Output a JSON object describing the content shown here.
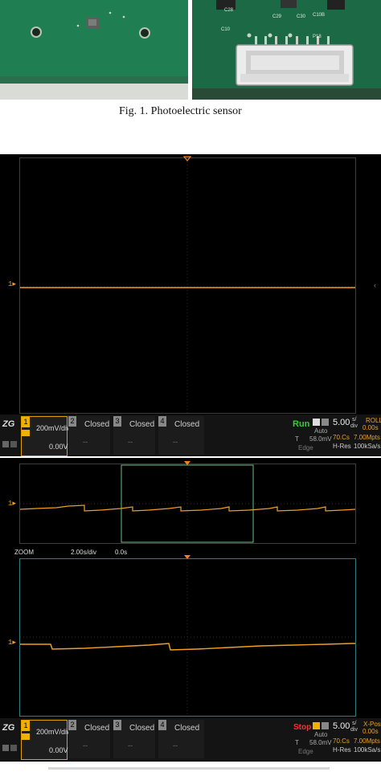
{
  "figure1": {
    "caption": "Fig. 1.  Photoelectric sensor",
    "right_photo_labels": [
      "C28",
      "C29",
      "C30",
      "C10",
      "C10B",
      "P18"
    ]
  },
  "scope1": {
    "channel_marker": "1",
    "trace_color": "#f0a020",
    "ch1": {
      "num": "1",
      "volts_div": "200mV/div",
      "offset": "0.00V"
    },
    "channels_closed": [
      {
        "num": "2",
        "label": "Closed",
        "dash": "--"
      },
      {
        "num": "3",
        "label": "Closed",
        "dash": "--"
      },
      {
        "num": "4",
        "label": "Closed",
        "dash": "--"
      }
    ],
    "run_label": "Run",
    "trigger_mode": "Auto",
    "trigger_letter": "T",
    "trigger_level": "58.0mV",
    "trigger_type": "Edge",
    "timebase": "5.00",
    "timebase_unit_top": "s/",
    "timebase_unit_bottom": "div",
    "mode": "ROLL",
    "mode_time": "0.00s",
    "memory": "70.Cs",
    "sample_rate": "7.00Mpts",
    "h_res": "H-Res",
    "h_res_rate": "100kSa/s"
  },
  "scope2": {
    "channel_marker": "1",
    "zoom_label": "ZOOM",
    "zoom_timebase": "2.00s/div",
    "zoom_offset": "0.0s",
    "ch1": {
      "num": "1",
      "volts_div": "200mV/div",
      "offset": "0.00V"
    },
    "channels_closed": [
      {
        "num": "2",
        "label": "Closed",
        "dash": "--"
      },
      {
        "num": "3",
        "label": "Closed",
        "dash": "--"
      },
      {
        "num": "4",
        "label": "Closed",
        "dash": "--"
      }
    ],
    "stop_label": "Stop",
    "trigger_mode": "Auto",
    "trigger_letter": "T",
    "trigger_level": "58.0mV",
    "trigger_type": "Edge",
    "timebase": "5.00",
    "timebase_unit_top": "s/",
    "timebase_unit_bottom": "div",
    "mode": "X-Pos",
    "mode_time": "0.00s",
    "memory": "70.Cs",
    "sample_rate": "7.00Mpts",
    "h_res": "H-Res",
    "h_res_rate": "100kSa/s"
  }
}
